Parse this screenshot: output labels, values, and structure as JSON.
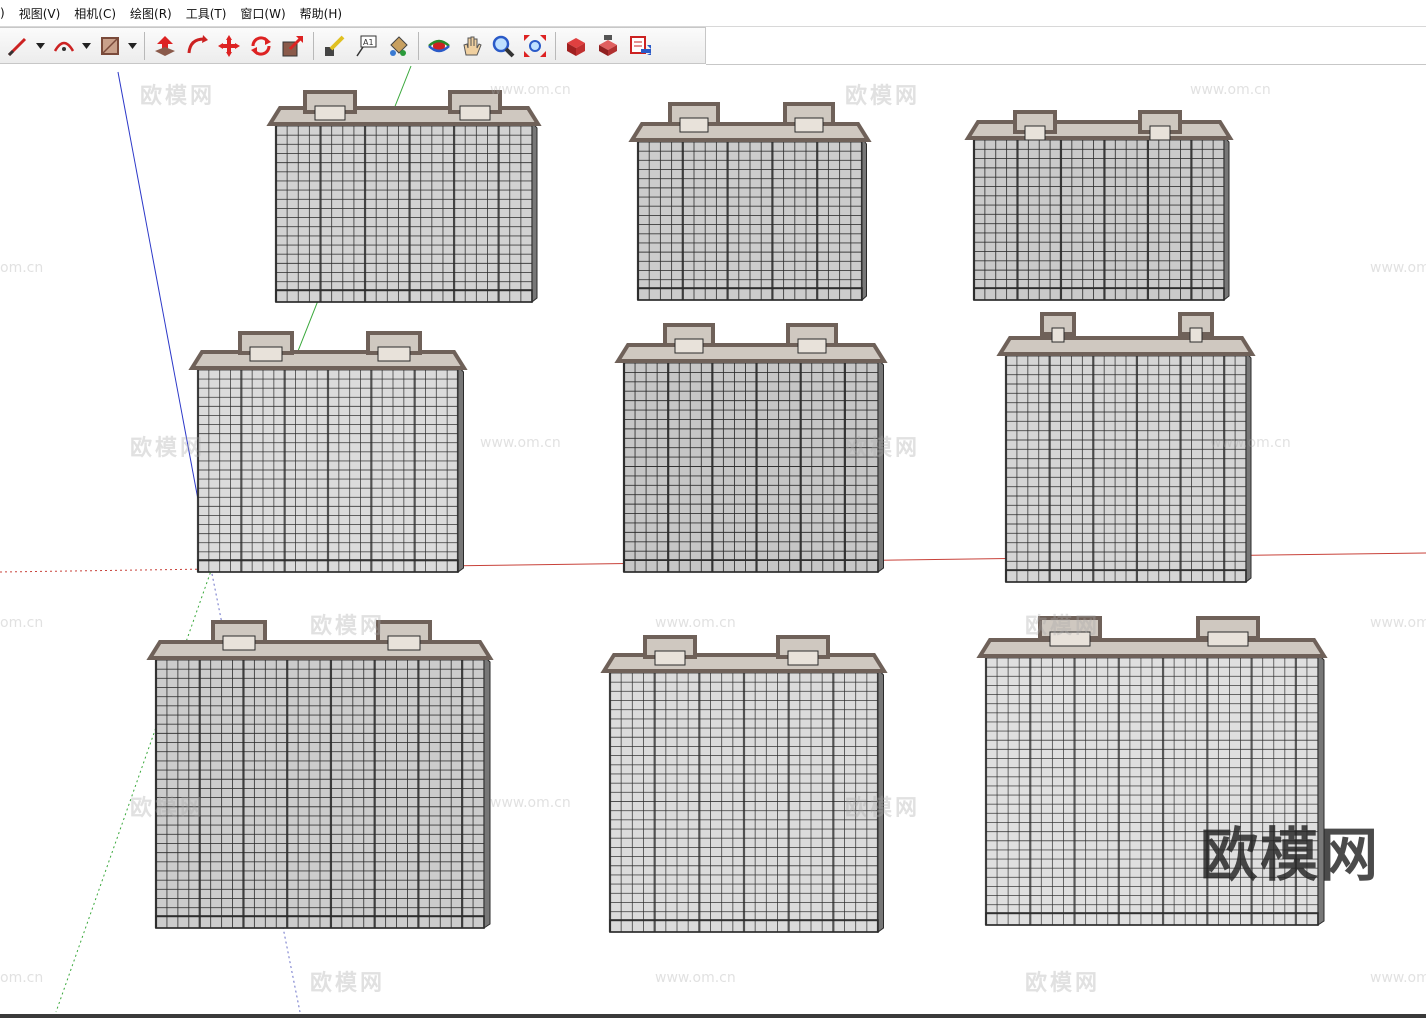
{
  "menu": {
    "items": [
      ")",
      "视图(V)",
      "相机(C)",
      "绘图(R)",
      "工具(T)",
      "窗口(W)",
      "帮助(H)"
    ]
  },
  "toolbar": {
    "groups": [
      [
        "pencil-line-icon",
        "arc-icon",
        "shape-rectangle-icon"
      ],
      [
        "push-pull-icon",
        "follow-me-icon",
        "move-icon",
        "rotate-icon",
        "scale-icon"
      ],
      [
        "tape-measure-icon",
        "text-label-icon",
        "paint-bucket-icon"
      ],
      [
        "orbit-icon",
        "pan-icon",
        "zoom-icon",
        "zoom-extents-icon"
      ],
      [
        "warehouse-get-models-icon",
        "warehouse-share-icon",
        "share-component-icon"
      ]
    ],
    "label_tool_text": "A1"
  },
  "watermarks": {
    "brand": "欧模网",
    "url": "www.om.cn",
    "url_short": "om.cn"
  },
  "colors": {
    "axis_red": "#c8423a",
    "axis_green": "#39a83b",
    "axis_blue": "#2c38c8",
    "building_dark": "#2b2b2b",
    "roof_top": "#cfc8c0",
    "parapet": "#6f6159"
  }
}
